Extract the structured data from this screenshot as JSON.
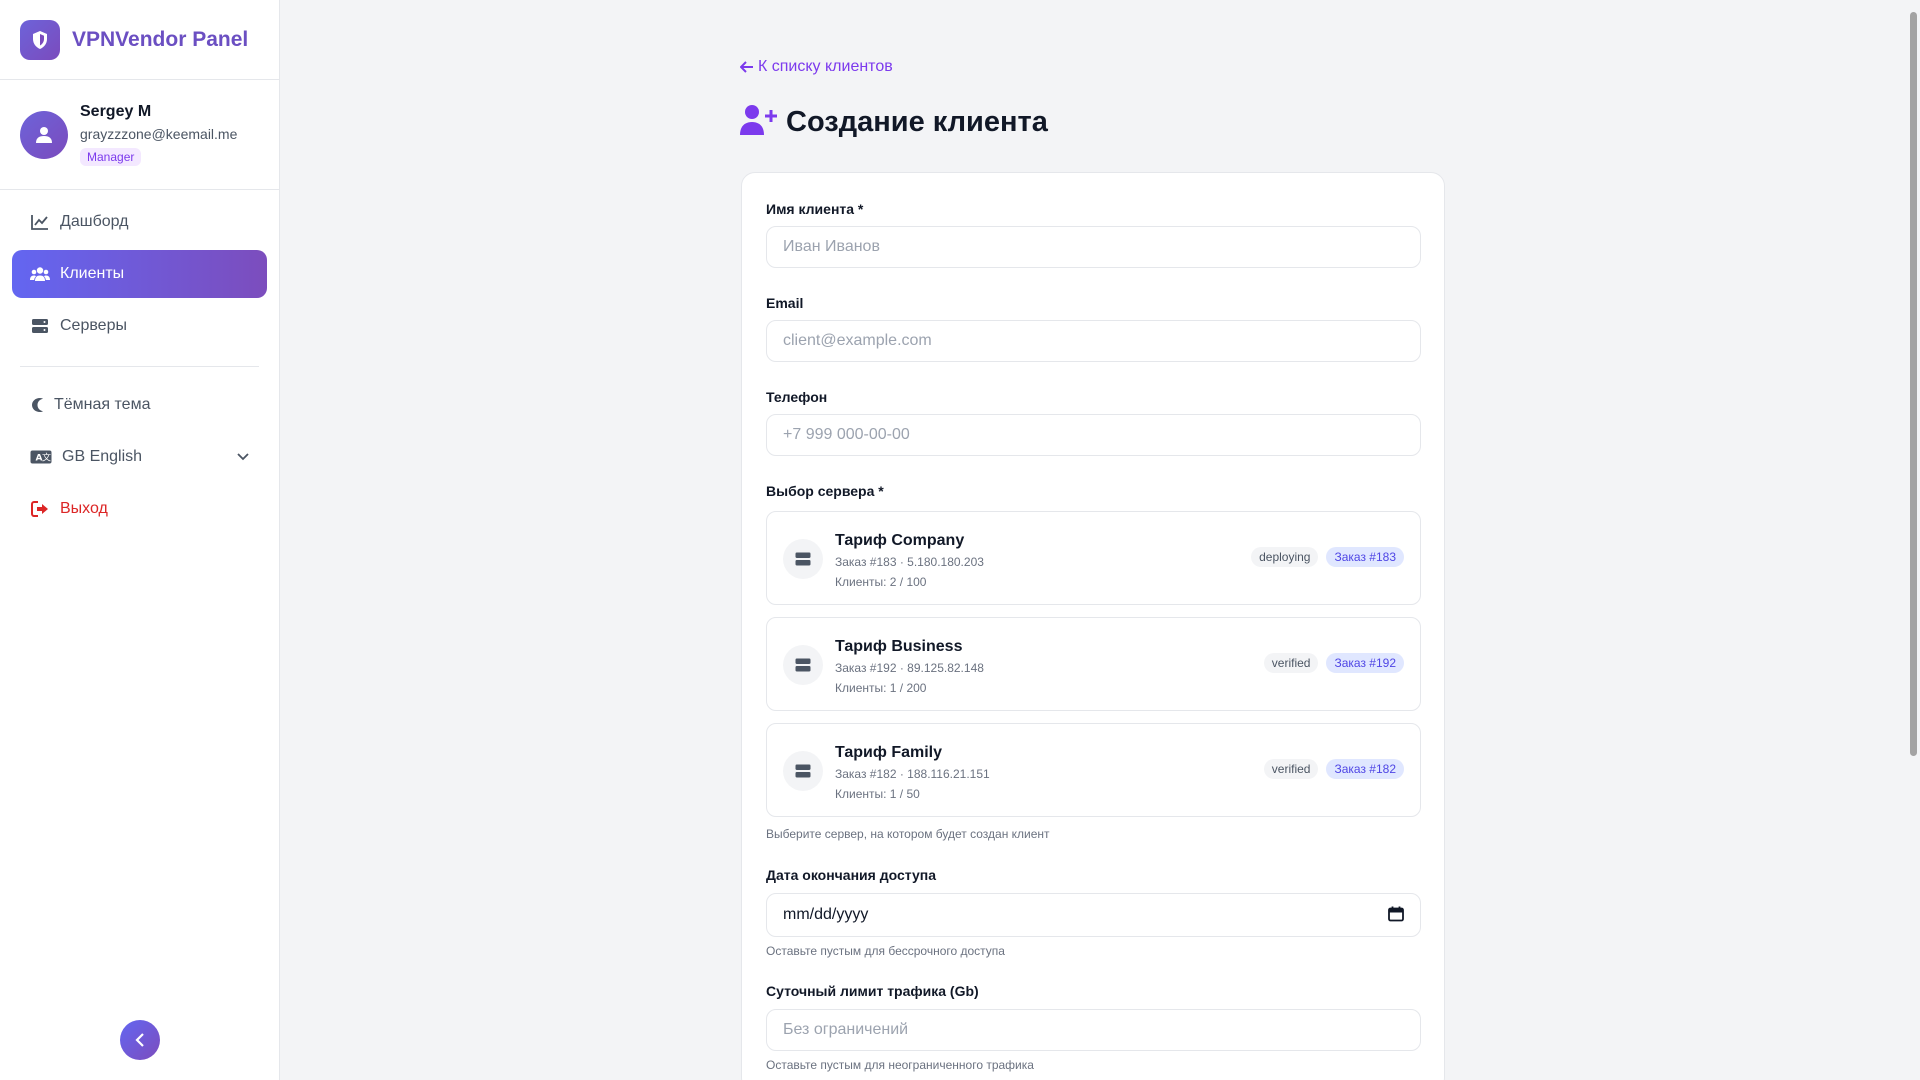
{
  "brand": {
    "title": "VPNVendor Panel",
    "logo_icon": "shield-icon"
  },
  "user": {
    "name": "Sergey M",
    "email": "grayzzzone@keemail.me",
    "role": "Manager"
  },
  "nav": {
    "items": [
      {
        "label": "Дашборд",
        "icon": "chart-line-icon",
        "active": false
      },
      {
        "label": "Клиенты",
        "icon": "users-icon",
        "active": true
      },
      {
        "label": "Серверы",
        "icon": "server-icon",
        "active": false
      }
    ],
    "theme_label": "Тёмная тема",
    "language_label": "GB English",
    "logout_label": "Выход"
  },
  "page": {
    "back_label": "К списку клиентов",
    "title": "Создание клиента"
  },
  "form": {
    "name": {
      "label": "Имя клиента *",
      "placeholder": "Иван Иванов"
    },
    "email": {
      "label": "Email",
      "placeholder": "client@example.com"
    },
    "phone": {
      "label": "Телефон",
      "placeholder": "+7 999 000-00-00"
    },
    "server_label": "Выбор сервера *",
    "servers": [
      {
        "name": "Тариф Company",
        "order_line": "Заказ #183 · 5.180.180.203",
        "clients_line": "Клиенты: 2 / 100",
        "status": "deploying",
        "order_badge": "Заказ #183"
      },
      {
        "name": "Тариф Business",
        "order_line": "Заказ #192 · 89.125.82.148",
        "clients_line": "Клиенты: 1 / 200",
        "status": "verified",
        "order_badge": "Заказ #192"
      },
      {
        "name": "Тариф Family",
        "order_line": "Заказ #182 · 188.116.21.151",
        "clients_line": "Клиенты: 1 / 50",
        "status": "verified",
        "order_badge": "Заказ #182"
      }
    ],
    "server_help": "Выберите сервер, на котором будет создан клиент",
    "expiry": {
      "label": "Дата окончания доступа",
      "placeholder": "mm/dd/yyyy",
      "help": "Оставьте пустым для бессрочного доступа"
    },
    "traffic": {
      "label": "Суточный лимит трафика (Gb)",
      "placeholder": "Без ограничений",
      "help": "Оставьте пустым для неограниченного трафика"
    }
  },
  "colors": {
    "accent": "#7c3aed",
    "gradient_start": "#6366f1",
    "gradient_end": "#7c4dbd",
    "danger": "#dc2626"
  }
}
